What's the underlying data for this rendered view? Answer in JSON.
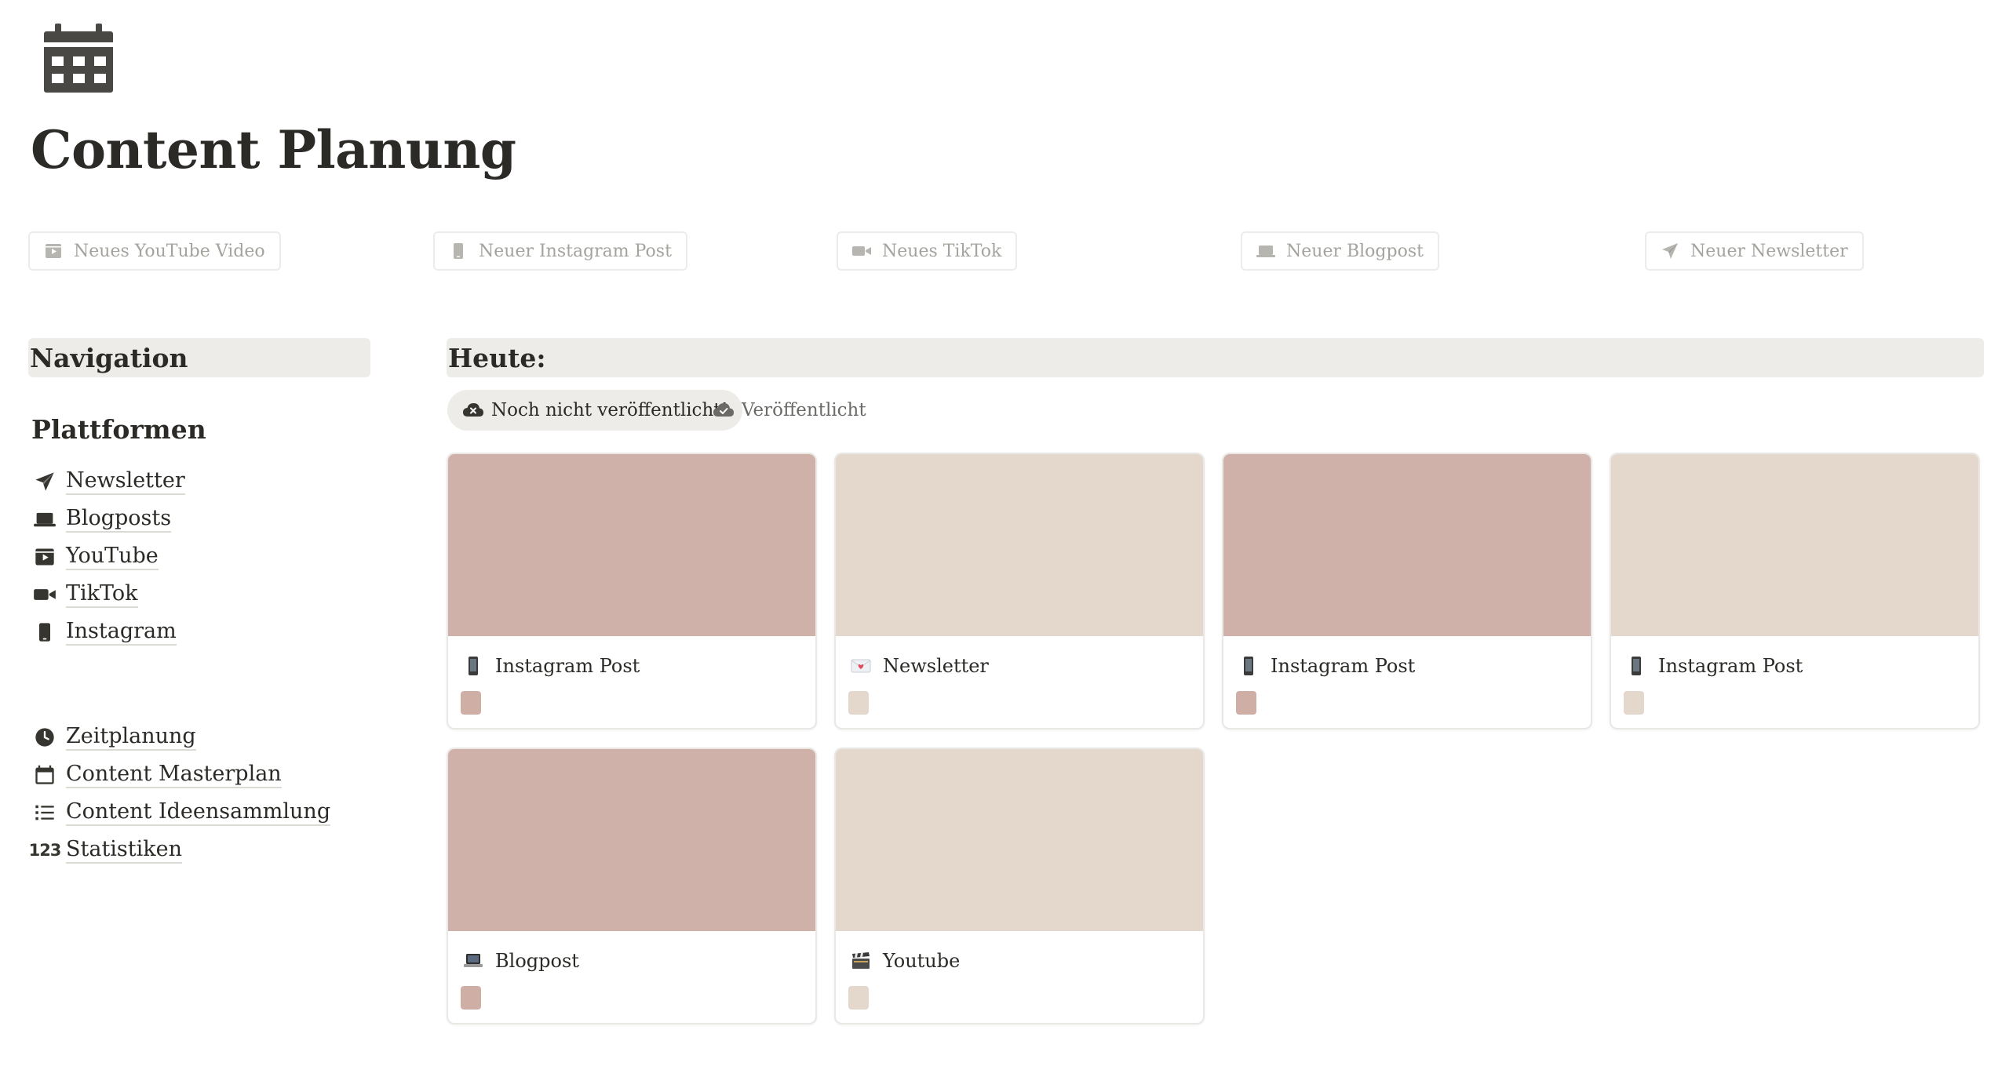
{
  "page": {
    "title": "Content Planung",
    "icon": "calendar-icon"
  },
  "quick_actions": [
    {
      "label": "Neues YouTube Video",
      "icon": "clapperboard-icon"
    },
    {
      "label": "Neuer Instagram Post",
      "icon": "smartphone-icon"
    },
    {
      "label": "Neues TikTok",
      "icon": "video-camera-icon"
    },
    {
      "label": "Neuer Blogpost",
      "icon": "laptop-icon"
    },
    {
      "label": "Neuer Newsletter",
      "icon": "paper-plane-icon"
    }
  ],
  "navigation": {
    "header": "Navigation",
    "platforms_heading": "Plattformen",
    "platforms": [
      {
        "label": "Newsletter",
        "icon": "paper-plane-icon"
      },
      {
        "label": "Blogposts",
        "icon": "laptop-icon"
      },
      {
        "label": "YouTube",
        "icon": "clapperboard-icon"
      },
      {
        "label": "TikTok",
        "icon": "video-camera-icon"
      },
      {
        "label": "Instagram",
        "icon": "smartphone-icon"
      }
    ],
    "links": [
      {
        "label": "Zeitplanung",
        "icon": "clock-icon"
      },
      {
        "label": "Content Masterplan",
        "icon": "calendar-icon"
      },
      {
        "label": "Content Ideensammlung",
        "icon": "list-icon"
      },
      {
        "label": "Statistiken",
        "icon": "numbers-icon",
        "icon_text": "123"
      }
    ]
  },
  "today": {
    "header": "Heute:",
    "tabs": [
      {
        "label": "Noch nicht veröffentlicht!",
        "icon": "cloud-x-icon",
        "active": true
      },
      {
        "label": "Veröffentlicht",
        "icon": "cloud-check-icon",
        "active": false
      }
    ],
    "cards": [
      {
        "title": "Instagram Post",
        "icon": "mobile-phone-emoji-icon",
        "cover_color": "#cfb1a9",
        "tag_color": "#cfaea6"
      },
      {
        "title": "Newsletter",
        "icon": "love-letter-emoji-icon",
        "cover_color": "#e4d8cc",
        "tag_color": "#e4d8cc"
      },
      {
        "title": "Instagram Post",
        "icon": "mobile-phone-emoji-icon",
        "cover_color": "#cfb1a9",
        "tag_color": "#cfaea6"
      },
      {
        "title": "Instagram Post",
        "icon": "mobile-phone-emoji-icon",
        "cover_color": "#e4d8cc",
        "tag_color": "#e4d8cc"
      },
      {
        "title": "Blogpost",
        "icon": "laptop-emoji-icon",
        "cover_color": "#cfb1a9",
        "tag_color": "#cfaea6"
      },
      {
        "title": "Youtube",
        "icon": "clapper-emoji-icon",
        "cover_color": "#e4d8cc",
        "tag_color": "#e4d8cc"
      }
    ]
  }
}
